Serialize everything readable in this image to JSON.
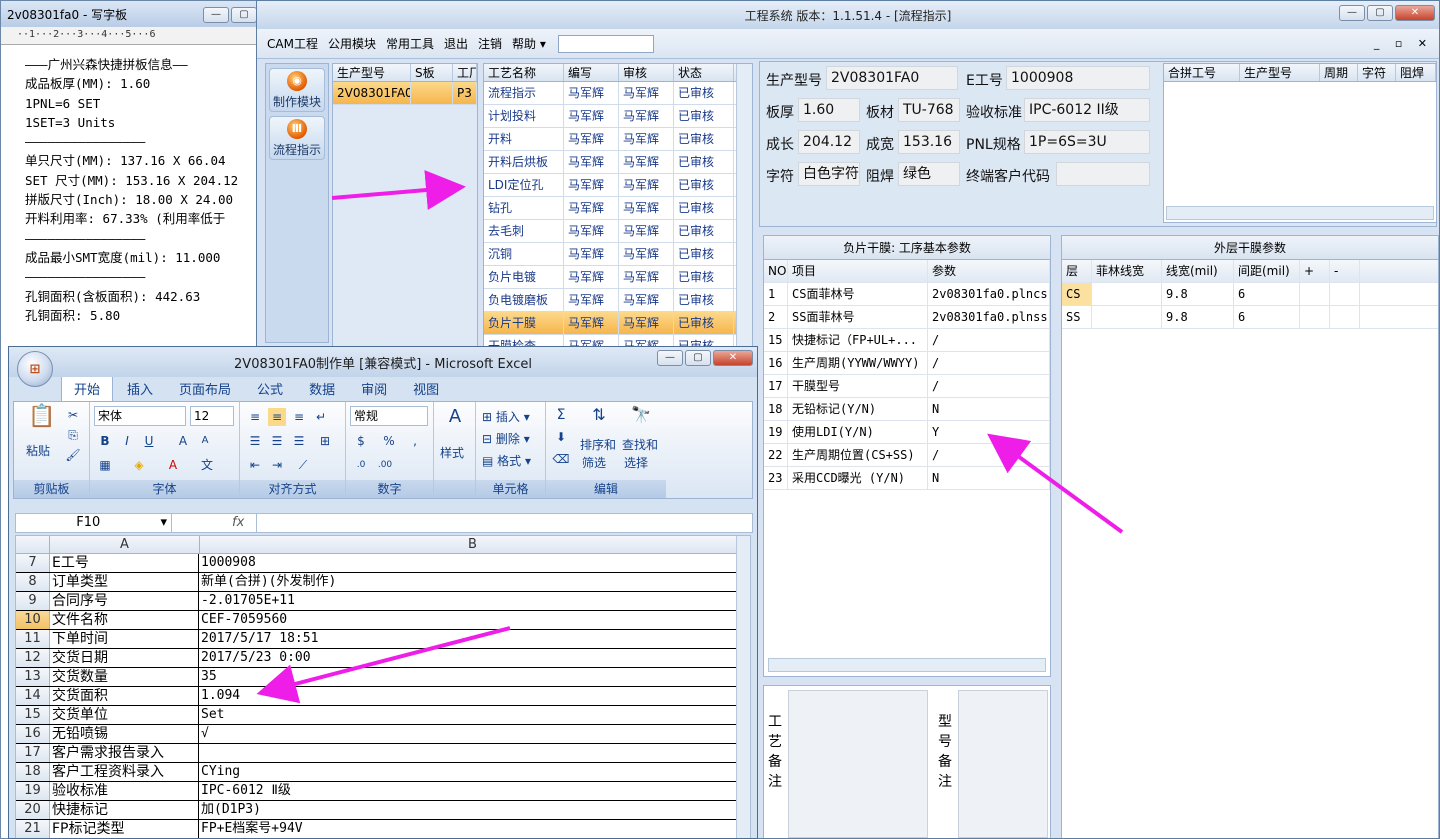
{
  "wordpad": {
    "title": "2v08301fa0 - 写字板",
    "ruler": "··1···2···3···4···5···6",
    "lines": [
      "———广州兴森快捷拼板信息——",
      "成品板厚(MM): 1.60",
      "1PNL=6 SET",
      "1SET=3 Units",
      "————————————————",
      "单只尺寸(MM): 137.16 X 66.04",
      "SET 尺寸(MM): 153.16 X 204.12",
      "拼版尺寸(Inch): 18.00 X 24.00",
      "开料利用率: 67.33% (利用率低于",
      "————————————————",
      "成品最小SMT宽度(mil): 11.000",
      "————————————————",
      "孔铜面积(含板面积): 442.63",
      "孔铜面积: 5.80"
    ]
  },
  "engineering": {
    "title": "工程系统  版本：1.1.51.4 - [流程指示]",
    "menu": [
      "CAM工程",
      "公用模块",
      "常用工具",
      "退出",
      "注销",
      "帮助"
    ],
    "left_buttons": [
      "制作模块",
      "流程指示"
    ],
    "product_grid": {
      "headers": [
        "生产型号",
        "S板",
        "工厂"
      ],
      "rows": [
        [
          "2V08301FA0",
          "",
          "P3"
        ]
      ]
    },
    "process_grid": {
      "headers": [
        "工艺名称",
        "编写",
        "审核",
        "状态"
      ],
      "rows": [
        [
          "流程指示",
          "马军辉",
          "马军辉",
          "已审核"
        ],
        [
          "计划投料",
          "马军辉",
          "马军辉",
          "已审核"
        ],
        [
          "开料",
          "马军辉",
          "马军辉",
          "已审核"
        ],
        [
          "开料后烘板",
          "马军辉",
          "马军辉",
          "已审核"
        ],
        [
          "LDI定位孔",
          "马军辉",
          "马军辉",
          "已审核"
        ],
        [
          "钻孔",
          "马军辉",
          "马军辉",
          "已审核"
        ],
        [
          "去毛刺",
          "马军辉",
          "马军辉",
          "已审核"
        ],
        [
          "沉铜",
          "马军辉",
          "马军辉",
          "已审核"
        ],
        [
          "负片电镀",
          "马军辉",
          "马军辉",
          "已审核"
        ],
        [
          "负电镀磨板",
          "马军辉",
          "马军辉",
          "已审核"
        ],
        [
          "负片干膜",
          "马军辉",
          "马军辉",
          "已审核"
        ],
        [
          "干膜检查",
          "马军辉",
          "马军辉",
          "已审核"
        ]
      ],
      "selected_index": 10
    },
    "info": {
      "prod_model_label": "生产型号",
      "prod_model": "2V08301FA0",
      "e_no_label": "E工号",
      "e_no": "1000908",
      "thickness_label": "板厚",
      "thickness": "1.60",
      "material_label": "板材",
      "material": "TU-768",
      "accept_label": "验收标准",
      "accept": "IPC-6012 II级",
      "length_label": "成长",
      "length": "204.12",
      "width_label": "成宽",
      "width": "153.16",
      "pnl_label": "PNL规格",
      "pnl": "1P=6S=3U",
      "char_label": "字符",
      "char": "白色字符",
      "mask_label": "阻焊",
      "mask": "绿色",
      "cust_label": "终端客户代码",
      "cust": ""
    },
    "combo_grid_headers": [
      "合拼工号",
      "生产型号",
      "周期",
      "字符",
      "阻焊"
    ],
    "neg_panel": {
      "title": "负片干膜: 工序基本参数",
      "headers": [
        "NO",
        "项目",
        "参数"
      ],
      "rows": [
        [
          "1",
          "CS面菲林号",
          "2v08301fa0.plncs"
        ],
        [
          "2",
          "SS面菲林号",
          "2v08301fa0.plnss"
        ],
        [
          "15",
          "快捷标记（FP+UL+...",
          "/"
        ],
        [
          "16",
          "生产周期(YYWW/WWYY)",
          "/"
        ],
        [
          "17",
          "干膜型号",
          "/"
        ],
        [
          "18",
          "无铅标记(Y/N)",
          "N"
        ],
        [
          "19",
          "使用LDI(Y/N)",
          "Y"
        ],
        [
          "22",
          "生产周期位置(CS+SS)",
          "/"
        ],
        [
          "23",
          "采用CCD曝光 (Y/N)",
          "N"
        ]
      ]
    },
    "outer_panel": {
      "title": "外层干膜参数",
      "headers": [
        "层",
        "菲林线宽",
        "线宽(mil)",
        "间距(mil)",
        "+",
        "-"
      ],
      "rows": [
        [
          "CS",
          "",
          "9.8",
          "6",
          "",
          ""
        ],
        [
          "SS",
          "",
          "9.8",
          "6",
          "",
          ""
        ]
      ]
    },
    "remark1": "工艺备注",
    "remark2": "型号备注"
  },
  "excel": {
    "title": "2V08301FA0制作单  [兼容模式] - Microsoft Excel",
    "office_icon": "office-logo",
    "tabs": [
      "开始",
      "插入",
      "页面布局",
      "公式",
      "数据",
      "审阅",
      "视图"
    ],
    "ribbon": {
      "paste": "粘贴",
      "clipboard": "剪贴板",
      "font_name": "宋体",
      "font_size": "12",
      "font": "字体",
      "align": "对齐方式",
      "number_format": "常规",
      "number": "数字",
      "style": "样式",
      "insert": "插入",
      "delete": "删除",
      "format": "格式",
      "cells": "单元格",
      "sort": "排序和",
      "sort2": "筛选",
      "find": "查找和",
      "find2": "选择",
      "editing": "编辑"
    },
    "name_box": "F10",
    "fx": "fx",
    "columns": [
      "A",
      "B"
    ],
    "rows": [
      [
        "7",
        "E工号",
        "1000908"
      ],
      [
        "8",
        "订单类型",
        "新单(合拼)(外发制作)"
      ],
      [
        "9",
        "合同序号",
        "-2.01705E+11"
      ],
      [
        "10",
        "文件名称",
        "CEF-7059560"
      ],
      [
        "11",
        "下单时间",
        "2017/5/17 18:51"
      ],
      [
        "12",
        "交货日期",
        "2017/5/23 0:00"
      ],
      [
        "13",
        "交货数量",
        "35"
      ],
      [
        "14",
        "交货面积",
        "1.094"
      ],
      [
        "15",
        "交货单位",
        "Set"
      ],
      [
        "16",
        "无铅喷锡",
        "√"
      ],
      [
        "17",
        "客户需求报告录入",
        ""
      ],
      [
        "18",
        "客户工程资料录入",
        "CYing"
      ],
      [
        "19",
        "验收标准",
        "IPC-6012 Ⅱ级"
      ],
      [
        "20",
        "快捷标记",
        "加(D1P3)"
      ],
      [
        "21",
        "FP标记类型",
        "FP+E档案号+94V"
      ]
    ],
    "highlighted_row": "10"
  },
  "colors": {
    "arrow": "#ee1ee8",
    "selected_row": "#f6b54d"
  }
}
